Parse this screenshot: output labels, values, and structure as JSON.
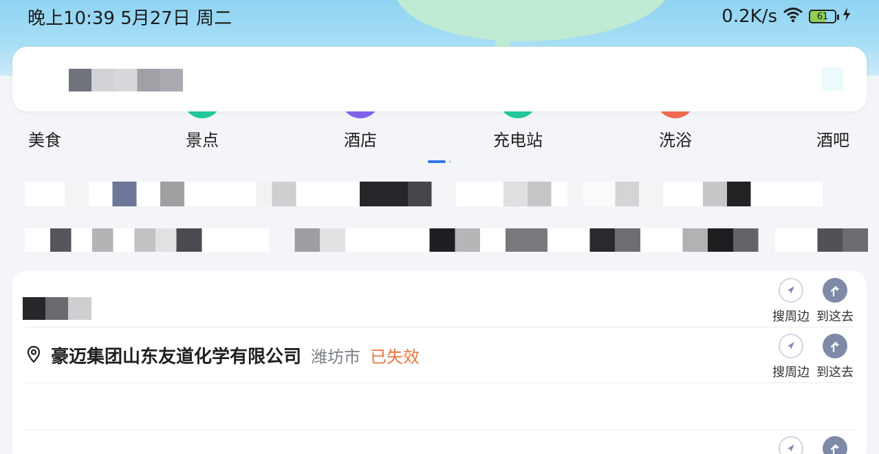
{
  "status_bar": {
    "time": "晚上10:39 5月27日 周二",
    "network_speed": "0.2K/s",
    "battery_level": "61"
  },
  "categories": [
    {
      "label": "美食",
      "color": "#ffffff"
    },
    {
      "label": "景点",
      "color": "#21c79c"
    },
    {
      "label": "酒店",
      "color": "#7d63e8"
    },
    {
      "label": "充电站",
      "color": "#21c79c"
    },
    {
      "label": "洗浴",
      "color": "#ef6a4e"
    },
    {
      "label": "酒吧",
      "color": "#ffffff"
    }
  ],
  "history": {
    "rows": [
      {
        "name": "",
        "city": "",
        "status": "",
        "actions": {
          "nearby": "搜周边",
          "go_here": "到这去"
        }
      },
      {
        "name": "豪迈集团山东友道化学有限公司",
        "city": "潍坊市",
        "status": "已失效",
        "actions": {
          "nearby": "搜周边",
          "go_here": "到这去"
        }
      }
    ]
  },
  "colors": {
    "accent": "#2f78e6",
    "invalid_status": "#e8743b",
    "action_fill": "#7e8aa8"
  }
}
